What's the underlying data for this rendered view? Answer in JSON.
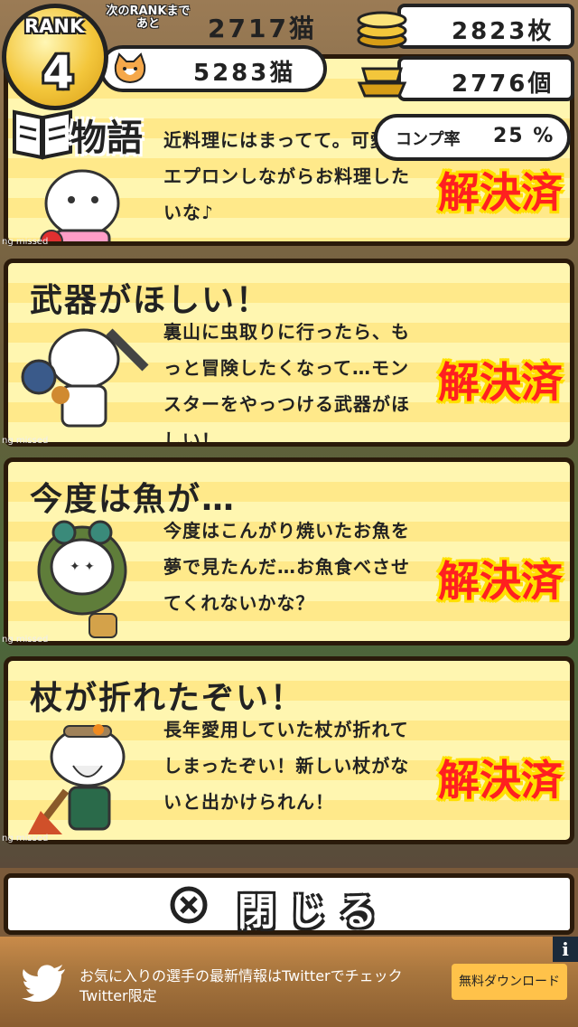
{
  "header": {
    "rank_label": "RANK",
    "rank_value": "4",
    "next_rank_label": "次のRANKまであと",
    "next_rank_value": "2717猫",
    "cats_value": "5283猫",
    "coins_value": "2823枚",
    "gold_value": "2776個"
  },
  "story": {
    "title": "物語",
    "completion_label": "コンプ率",
    "completion_value": "25 %"
  },
  "requests": [
    {
      "title": "",
      "body": "近料理にはまってて。可愛いエプロンしながらお料理したいな♪",
      "status": "解決済"
    },
    {
      "title": "武器がほしい！",
      "body": "裏山に虫取りに行ったら、もっと冒険したくなって…モンスターをやっつける武器がほしい！",
      "status": "解決済"
    },
    {
      "title": "今度は魚が…",
      "body": "今度はこんがり焼いたお魚を夢で見たんだ…お魚食べさせてくれないかな？",
      "status": "解決済"
    },
    {
      "title": "杖が折れたぞい！",
      "body": "長年愛用していた杖が折れてしまったぞい！新しい杖がないと出かけられん！",
      "status": "解決済"
    }
  ],
  "close_button": {
    "label": "閉じる"
  },
  "ad": {
    "line1": "お気に入りの選手の最新情報はTwitterでチェック",
    "line2": "Twitter限定",
    "button": "無料ダウンロード",
    "info": "i"
  },
  "missed_labels": [
    "ng missed",
    "ng missed",
    "ng missed",
    "ng missed"
  ],
  "colors": {
    "solved": "#ff2020",
    "panel_stripe_a": "#fff6b0",
    "panel_stripe_b": "#ffe98a"
  }
}
